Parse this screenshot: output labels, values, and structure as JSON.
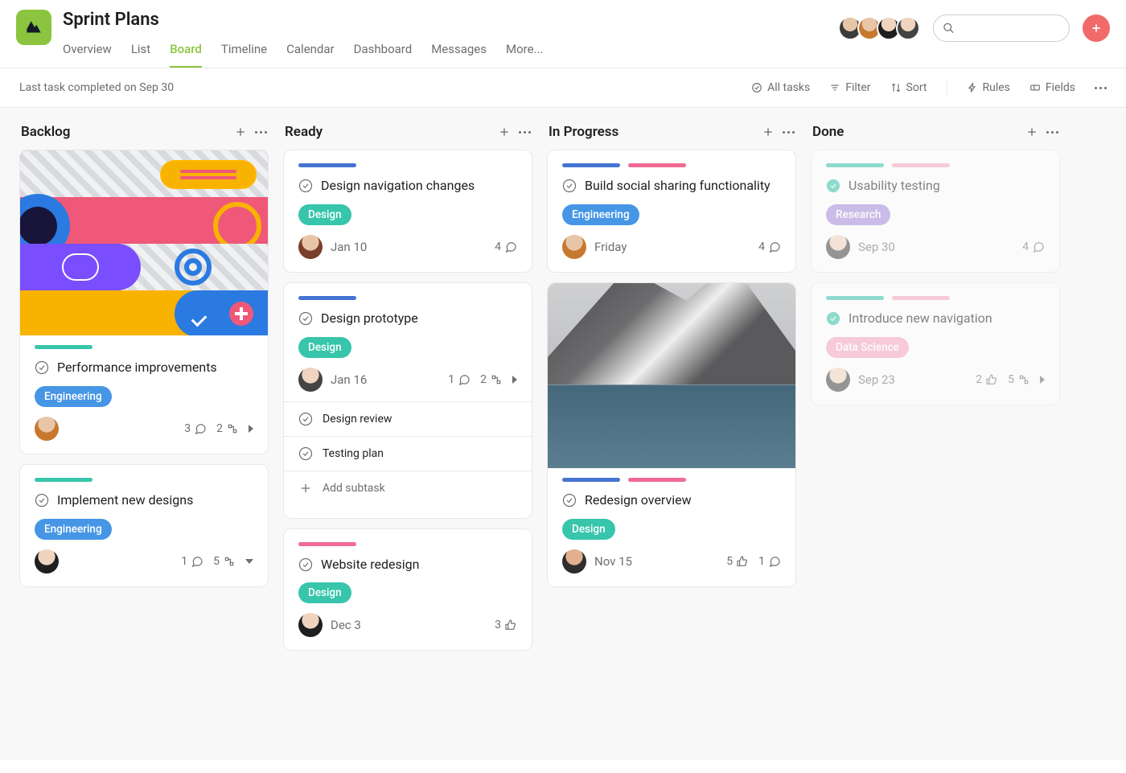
{
  "project": {
    "title": "Sprint Plans"
  },
  "tabs": [
    "Overview",
    "List",
    "Board",
    "Timeline",
    "Calendar",
    "Dashboard",
    "Messages",
    "More..."
  ],
  "active_tab": "Board",
  "toolbar": {
    "status": "Last task completed on Sep 30",
    "all_tasks": "All tasks",
    "filter": "Filter",
    "sort": "Sort",
    "rules": "Rules",
    "fields": "Fields"
  },
  "search": {
    "placeholder": ""
  },
  "columns": [
    {
      "id": "backlog",
      "title": "Backlog",
      "cards": [
        {
          "cover": "abstract",
          "stripes": [
            "teal"
          ],
          "title": "Performance improvements",
          "tags": [
            {
              "label": "Engineering",
              "color": "blue"
            }
          ],
          "avatar": "av-d",
          "date": "",
          "meta": [
            {
              "n": "3",
              "icon": "comment"
            },
            {
              "n": "2",
              "icon": "subtask"
            },
            {
              "icon": "caret"
            }
          ]
        },
        {
          "stripes": [
            "teal"
          ],
          "title": "Implement new designs",
          "tags": [
            {
              "label": "Engineering",
              "color": "blue"
            }
          ],
          "avatar": "av-c",
          "date": "",
          "meta": [
            {
              "n": "1",
              "icon": "comment"
            },
            {
              "n": "5",
              "icon": "subtask"
            },
            {
              "icon": "caret-down"
            }
          ]
        }
      ]
    },
    {
      "id": "ready",
      "title": "Ready",
      "cards": [
        {
          "stripes": [
            "blue"
          ],
          "title": "Design navigation changes",
          "tags": [
            {
              "label": "Design",
              "color": "teal"
            }
          ],
          "avatar": "av-b",
          "date": "Jan 10",
          "meta": [
            {
              "n": "4",
              "icon": "comment"
            }
          ]
        },
        {
          "stripes": [
            "blue"
          ],
          "title": "Design prototype",
          "tags": [
            {
              "label": "Design",
              "color": "teal"
            }
          ],
          "avatar": "av-e",
          "date": "Jan 16",
          "meta": [
            {
              "n": "1",
              "icon": "comment"
            },
            {
              "n": "2",
              "icon": "subtask"
            },
            {
              "icon": "caret"
            }
          ],
          "subtasks": [
            "Design review",
            "Testing plan"
          ],
          "add_subtask": "Add subtask"
        },
        {
          "stripes": [
            "pink"
          ],
          "title": "Website redesign",
          "tags": [
            {
              "label": "Design",
              "color": "teal"
            }
          ],
          "avatar": "av-c",
          "date": "Dec 3",
          "meta": [
            {
              "n": "3",
              "icon": "like"
            }
          ]
        }
      ]
    },
    {
      "id": "inprogress",
      "title": "In Progress",
      "cards": [
        {
          "stripes": [
            "blue",
            "pink"
          ],
          "title": "Build social sharing functionality",
          "tags": [
            {
              "label": "Engineering",
              "color": "blue"
            }
          ],
          "avatar": "av-d",
          "date": "Friday",
          "meta": [
            {
              "n": "4",
              "icon": "comment"
            }
          ]
        },
        {
          "cover": "mountain",
          "stripes": [
            "blue",
            "pink"
          ],
          "title": "Redesign overview",
          "tags": [
            {
              "label": "Design",
              "color": "teal"
            }
          ],
          "avatar": "av-f",
          "date": "Nov 15",
          "meta": [
            {
              "n": "5",
              "icon": "like"
            },
            {
              "n": "1",
              "icon": "comment"
            }
          ]
        }
      ]
    },
    {
      "id": "done",
      "title": "Done",
      "cards": [
        {
          "done": true,
          "stripes": [
            "teal",
            "pink-l"
          ],
          "title": "Usability testing",
          "tags": [
            {
              "label": "Research",
              "color": "purple"
            }
          ],
          "avatar": "av-e",
          "date": "Sep 30",
          "meta": [
            {
              "n": "4",
              "icon": "comment"
            }
          ]
        },
        {
          "done": true,
          "stripes": [
            "teal",
            "pink-l"
          ],
          "title": "Introduce new navigation",
          "tags": [
            {
              "label": "Data Science",
              "color": "pink-l"
            }
          ],
          "avatar": "av-e",
          "date": "Sep 23",
          "meta": [
            {
              "n": "2",
              "icon": "like"
            },
            {
              "n": "5",
              "icon": "subtask"
            },
            {
              "icon": "caret"
            }
          ]
        }
      ]
    }
  ]
}
